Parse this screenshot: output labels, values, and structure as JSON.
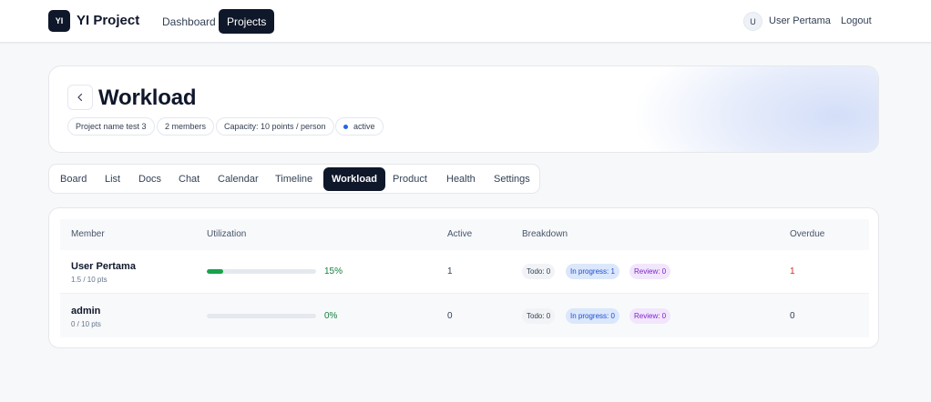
{
  "topbar": {
    "logo_text": "YI",
    "brand": "YI Project",
    "nav": [
      {
        "label": "Dashboard",
        "active": false
      },
      {
        "label": "Projects",
        "active": true
      }
    ],
    "user_initial": "U",
    "user_name": "User Pertama",
    "logout_label": "Logout"
  },
  "header": {
    "title": "Workload",
    "pills": {
      "project": "Project name test 3",
      "members": "2 members",
      "capacity": "Capacity: 10 points / person",
      "status": "active"
    }
  },
  "tabs": [
    {
      "label": "Board",
      "active": false
    },
    {
      "label": "List",
      "active": false
    },
    {
      "label": "Docs",
      "active": false
    },
    {
      "label": "Chat",
      "active": false
    },
    {
      "label": "Calendar",
      "active": false
    },
    {
      "label": "Timeline",
      "active": false
    },
    {
      "label": "Workload",
      "active": true
    },
    {
      "label": "Product",
      "active": false
    },
    {
      "label": "Health",
      "active": false
    },
    {
      "label": "Settings",
      "active": false
    }
  ],
  "table": {
    "columns": {
      "member": "Member",
      "utilization": "Utilization",
      "active": "Active",
      "breakdown": "Breakdown",
      "overdue": "Overdue"
    },
    "rows": [
      {
        "name": "User Pertama",
        "points": "1.5 / 10 pts",
        "utilization_fraction": 0.15,
        "utilization_label": "15%",
        "active": "1",
        "todo": "Todo: 0",
        "in_progress": "In progress: 1",
        "review": "Review: 0",
        "overdue": "1",
        "overdue_color": "#dc2626"
      },
      {
        "name": "admin",
        "points": "0 / 10 pts",
        "utilization_fraction": 0,
        "utilization_label": "0%",
        "active": "0",
        "todo": "Todo: 0",
        "in_progress": "In progress: 0",
        "review": "Review: 0",
        "overdue": "0",
        "overdue_color": "#334155"
      }
    ]
  },
  "colors": {
    "accent_dark": "#0f172a",
    "progress_green": "#16a34a",
    "status_blue": "#2563eb"
  }
}
